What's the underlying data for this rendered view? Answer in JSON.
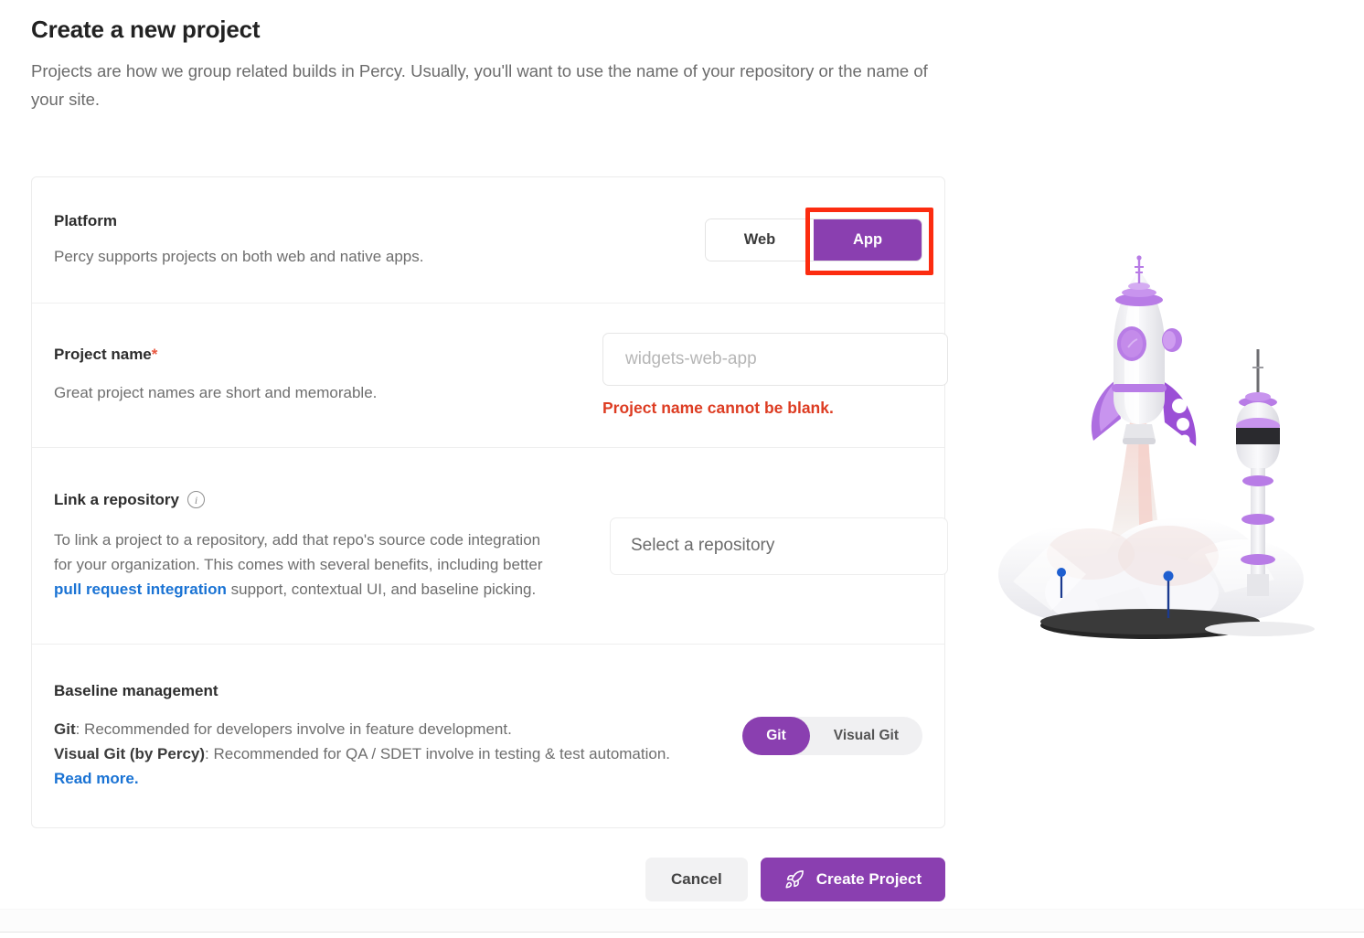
{
  "header": {
    "title": "Create a new project",
    "subtitle": "Projects are how we group related builds in Percy. Usually, you'll want to use the name of your repository or the name of your site."
  },
  "platform": {
    "label": "Platform",
    "help": "Percy supports projects on both web and native apps.",
    "options": [
      "Web",
      "App"
    ],
    "selected": "App",
    "highlight_color": "#fc2c10"
  },
  "project_name": {
    "label": "Project name",
    "required_marker": "*",
    "help": "Great project names are short and memorable.",
    "placeholder": "widgets-web-app",
    "value": "",
    "error": "Project name cannot be blank.",
    "error_color": "#dd3c22"
  },
  "repository": {
    "label": "Link a repository",
    "info_icon": "info-circle-icon",
    "help_part1": "To link a project to a repository, add that repo's source code integration for your organization. This comes with several benefits, including better ",
    "help_link": "pull request integration",
    "help_part2": " support, contextual UI, and baseline picking.",
    "select_placeholder": "Select a repository"
  },
  "baseline": {
    "label": "Baseline management",
    "git_bold": "Git",
    "git_text": ": Recommended for developers involve in feature development.",
    "visual_git_bold": "Visual Git (by Percy)",
    "visual_git_text": ": Recommended for QA / SDET involve in testing & test automation. ",
    "read_more": "Read more.",
    "options": [
      "Git",
      "Visual Git"
    ],
    "selected": "Git"
  },
  "actions": {
    "cancel": "Cancel",
    "create": "Create Project",
    "create_icon": "rocket-icon"
  },
  "theme": {
    "accent_purple": "#8A3FB0",
    "link_blue": "#1a73d4",
    "text_dark": "#2d2d2d",
    "text_muted": "#6e6e6e"
  }
}
